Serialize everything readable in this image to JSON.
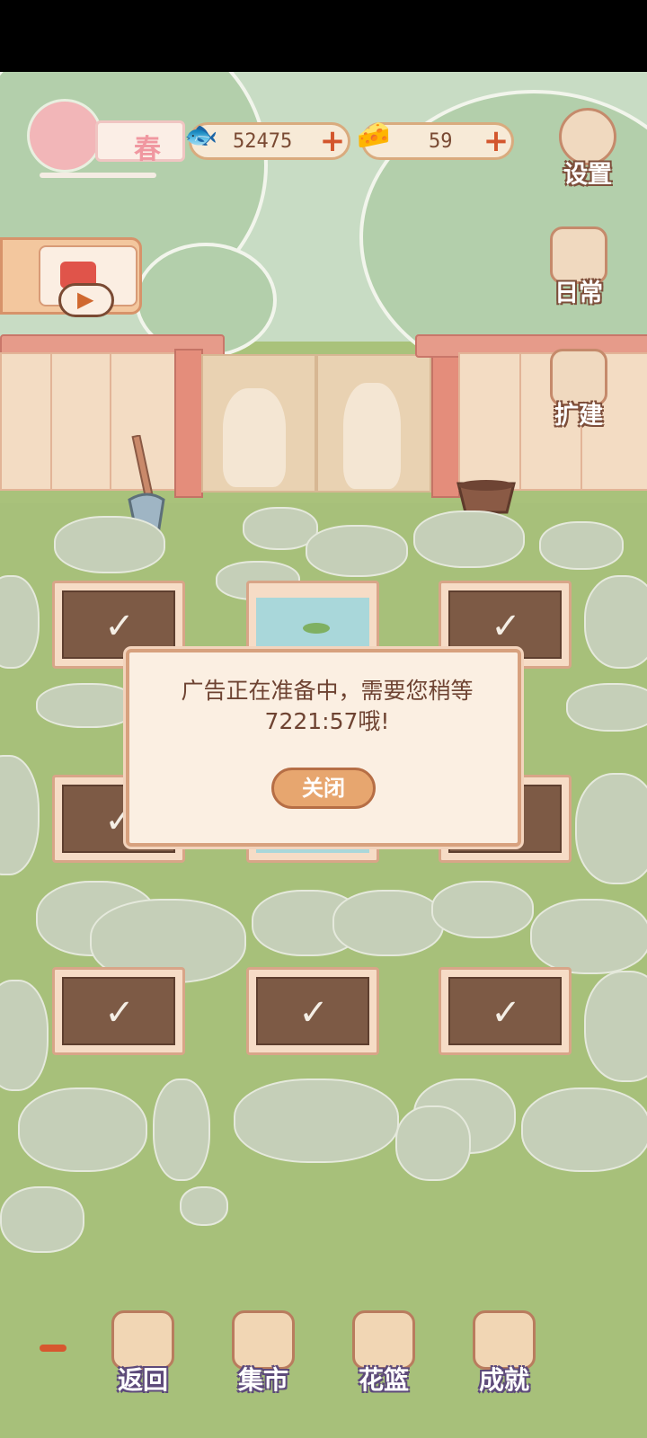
{
  "hud": {
    "season": "春",
    "fish_count": "52475",
    "cheese_count": "59",
    "plus_glyph": "+"
  },
  "side_menu": {
    "settings_label": "设置",
    "daily_label": "日常",
    "expand_label": "扩建"
  },
  "dialog": {
    "message": "广告正在准备中，需要您稍等7221:57哦!",
    "close_label": "关闭"
  },
  "bottom_nav": {
    "back_label": "返回",
    "market_label": "集市",
    "basket_label": "花篮",
    "achievements_label": "成就"
  },
  "plots": [
    {
      "type": "soil"
    },
    {
      "type": "water"
    },
    {
      "type": "soil"
    },
    {
      "type": "soil"
    },
    {
      "type": "water"
    },
    {
      "type": "soil"
    },
    {
      "type": "soil"
    },
    {
      "type": "soil"
    },
    {
      "type": "soil"
    }
  ],
  "icons": {
    "sprout": "✓",
    "play": "▶"
  },
  "colors": {
    "accent": "#d3562d",
    "label_outline": "#7d4e3a"
  }
}
